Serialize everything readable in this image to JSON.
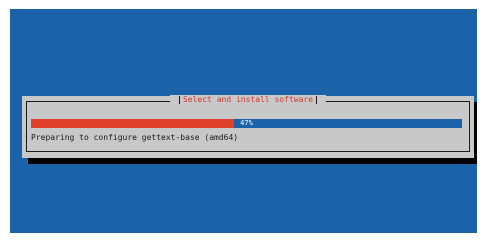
{
  "dialog": {
    "title": "Select and install software",
    "status": "Preparing to configure gettext-base (amd64)"
  },
  "progress": {
    "percent": 47,
    "label": "47%"
  },
  "colors": {
    "background": "#1a63a8",
    "dialog": "#c8c8c8",
    "title": "#d13a2a",
    "progress_fill": "#e0412d",
    "progress_track": "#1a63a8"
  }
}
